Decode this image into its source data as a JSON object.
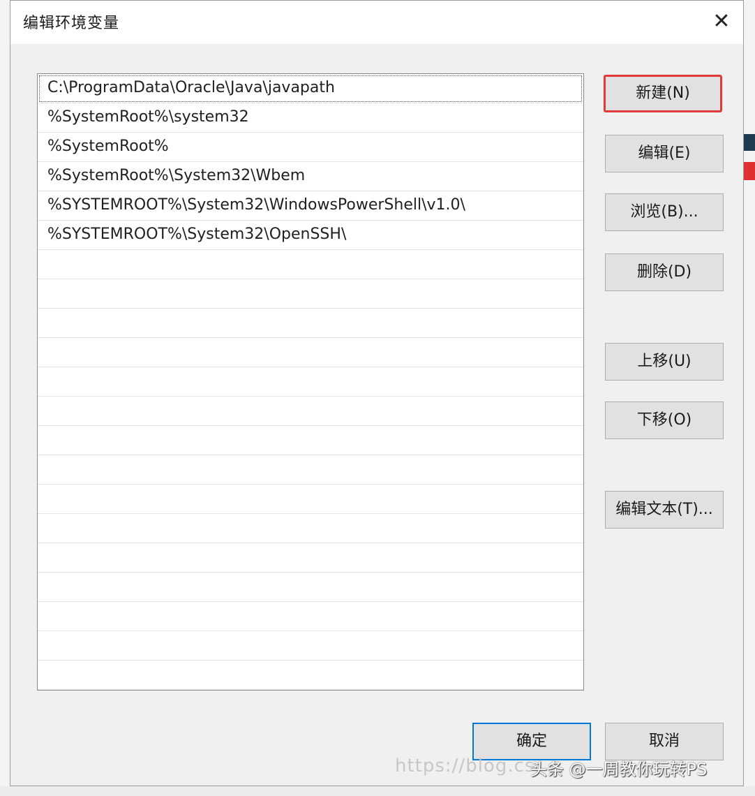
{
  "dialog": {
    "title": "编辑环境变量",
    "close_glyph": "✕"
  },
  "paths": [
    "C:\\ProgramData\\Oracle\\Java\\javapath",
    "%SystemRoot%\\system32",
    "%SystemRoot%",
    "%SystemRoot%\\System32\\Wbem",
    "%SYSTEMROOT%\\System32\\WindowsPowerShell\\v1.0\\",
    "%SYSTEMROOT%\\System32\\OpenSSH\\"
  ],
  "empty_rows": 15,
  "buttons": {
    "new": "新建(N)",
    "edit": "编辑(E)",
    "browse": "浏览(B)...",
    "delete": "删除(D)",
    "move_up": "上移(U)",
    "move_down": "下移(O)",
    "edit_text": "编辑文本(T)...",
    "ok": "确定",
    "cancel": "取消"
  },
  "watermark": {
    "text": "https://blog.cs",
    "brand": "头条 @一周教你玩转PS"
  },
  "colors": {
    "highlight_border": "#e03a3a",
    "default_button_border": "#0078d7"
  }
}
